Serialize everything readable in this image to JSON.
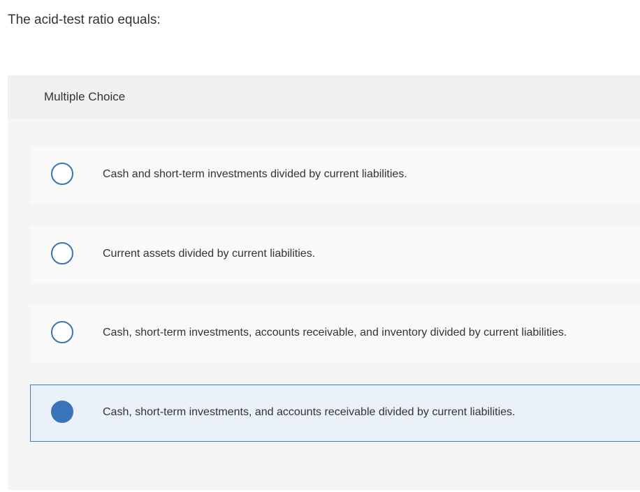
{
  "question": {
    "text": "The acid-test ratio equals:"
  },
  "multiple_choice": {
    "header_label": "Multiple Choice",
    "selected_index": 3,
    "options": [
      {
        "label": "Cash and short-term investments divided by current liabilities.",
        "selected": false
      },
      {
        "label": "Current assets divided by current liabilities.",
        "selected": false
      },
      {
        "label": "Cash, short-term investments, accounts receivable, and inventory divided by current liabilities.",
        "selected": false
      },
      {
        "label": "Cash, short-term investments, and accounts receivable divided by current liabilities.",
        "selected": true
      }
    ]
  },
  "colors": {
    "accent": "#3b73b9",
    "selected_background": "#eaf1f9",
    "panel_background": "#f5f5f5",
    "option_background": "#f9f9f9"
  }
}
